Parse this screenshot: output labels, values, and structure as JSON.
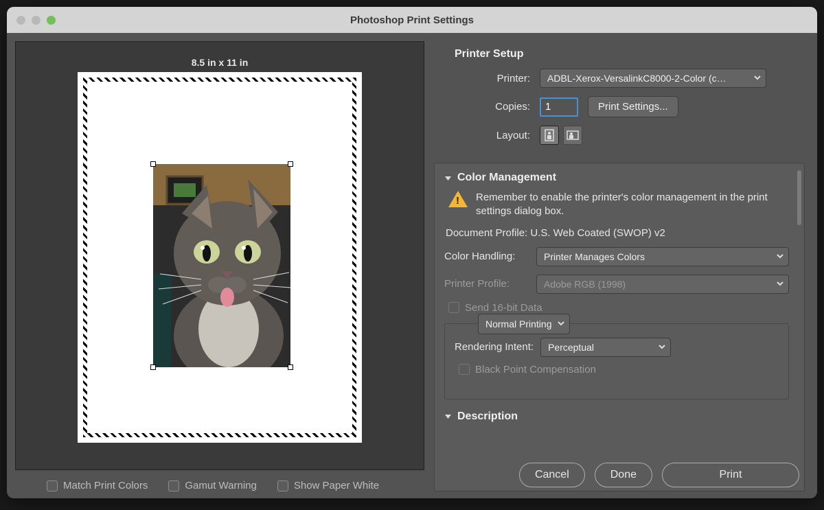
{
  "window": {
    "title": "Photoshop Print Settings"
  },
  "preview": {
    "page_dimensions": "8.5 in x 11 in"
  },
  "lower_checks": {
    "match_print_colors": "Match Print Colors",
    "gamut_warning": "Gamut Warning",
    "show_paper_white": "Show Paper White"
  },
  "printer_setup": {
    "heading": "Printer Setup",
    "printer_label": "Printer:",
    "printer_value": "ADBL-Xerox-VersalinkC8000-2-Color (c…",
    "copies_label": "Copies:",
    "copies_value": "1",
    "print_settings_btn": "Print Settings...",
    "layout_label": "Layout:"
  },
  "color_management": {
    "heading": "Color Management",
    "warning": "Remember to enable the printer's color management in the print settings dialog box.",
    "doc_profile_label": "Document Profile:",
    "doc_profile_value": "U.S. Web Coated (SWOP) v2",
    "color_handling_label": "Color Handling:",
    "color_handling_value": "Printer Manages Colors",
    "printer_profile_label": "Printer Profile:",
    "printer_profile_value": "Adobe RGB (1998)",
    "send_16bit": "Send 16-bit Data",
    "mode_value": "Normal Printing",
    "rendering_intent_label": "Rendering Intent:",
    "rendering_intent_value": "Perceptual",
    "black_point_comp": "Black Point Compensation"
  },
  "description": {
    "heading": "Description"
  },
  "footer": {
    "cancel": "Cancel",
    "done": "Done",
    "print": "Print"
  }
}
